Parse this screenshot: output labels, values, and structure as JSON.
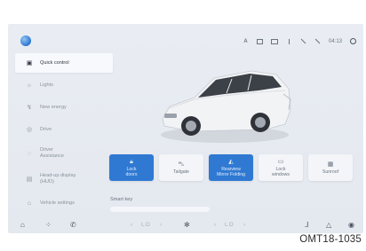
{
  "status_bar": {
    "time": "04:13",
    "icons": [
      "a-icon",
      "screen-icon",
      "battery-icon",
      "signal-icon",
      "wifi-off-icon",
      "no-call-icon",
      "settings-icon"
    ]
  },
  "sidebar": {
    "items": [
      {
        "label": "Quick control",
        "icon": "car-icon",
        "active": true
      },
      {
        "label": "Lights",
        "icon": "light-icon",
        "active": false
      },
      {
        "label": "New energy",
        "icon": "energy-icon",
        "active": false
      },
      {
        "label": "Drive",
        "icon": "drive-icon",
        "active": false
      },
      {
        "label": "Driver\nAssistance",
        "icon": "assist-icon",
        "active": false
      },
      {
        "label": "Head-up display\n(HUD)",
        "icon": "hud-icon",
        "active": false
      },
      {
        "label": "Vehicle settings",
        "icon": "vehicle-icon",
        "active": false
      }
    ]
  },
  "controls": [
    {
      "label": "Lock\ndoors",
      "icon": "lock-icon",
      "active": true
    },
    {
      "label": "Tailgate",
      "icon": "tailgate-icon",
      "active": false
    },
    {
      "label": "Rearview\nMirror Folding",
      "icon": "mirror-icon",
      "active": true
    },
    {
      "label": "Lock\nwindows",
      "icon": "window-icon",
      "active": false
    },
    {
      "label": "Sunroof",
      "icon": "sunroof-icon",
      "active": false
    }
  ],
  "smart_key": {
    "label": "Smart key"
  },
  "dock": {
    "left_temp": "LO",
    "right_temp": "LO"
  },
  "figure_code": "OMT18-1035",
  "colors": {
    "accent": "#2f79d2",
    "panel": "#e9edf3"
  }
}
